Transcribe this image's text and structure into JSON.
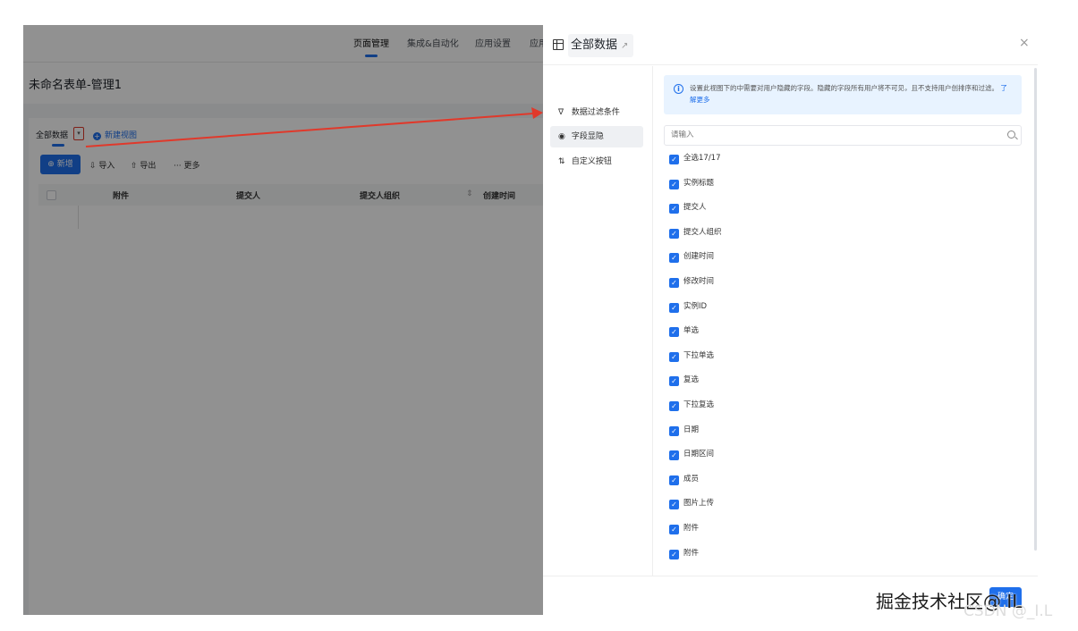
{
  "app": {
    "nav_tabs": [
      "页面管理",
      "集成&自动化",
      "应用设置",
      "应用"
    ],
    "active_tab": "页面管理",
    "form_title": "未命名表单-管理1",
    "view_tab": "全部数据",
    "new_view": "新建视图",
    "toolbar": {
      "add": "⊕ 新增",
      "import": "⇩ 导入",
      "export": "⇧ 导出",
      "more": "··· 更多"
    },
    "columns": [
      "附件",
      "提交人",
      "提交人组织",
      "创建时间"
    ]
  },
  "panel": {
    "title": "全部数据",
    "close": "×",
    "side_menu": [
      {
        "icon": "filter-icon",
        "glyph": "∇",
        "label": "数据过滤条件"
      },
      {
        "icon": "eye-icon",
        "glyph": "◉",
        "label": "字段显隐"
      },
      {
        "icon": "sort-icon",
        "glyph": "⇅",
        "label": "自定义按钮"
      }
    ],
    "selected_side": "字段显隐",
    "info_text": "设置此视图下的中需要对用户隐藏的字段。隐藏的字段所有用户将不可见，且不支持用户创排序和过滤。",
    "info_link": "了解更多",
    "search_placeholder": "请输入",
    "select_all": "全选17/17",
    "fields": [
      "实例标题",
      "提交人",
      "提交人组织",
      "创建时间",
      "修改时间",
      "实例ID",
      "单选",
      "下拉单选",
      "复选",
      "下拉复选",
      "日期",
      "日期区间",
      "成员",
      "图片上传",
      "附件",
      "附件"
    ],
    "ok_label": "确定"
  },
  "watermark": {
    "line1": "掘金技术社区@ IL",
    "line2": "CSDN @_I.L"
  },
  "colors": {
    "accent": "#1f6feb",
    "arrow": "#e0392b",
    "overlay": "rgba(0,0,0,0.43)"
  }
}
